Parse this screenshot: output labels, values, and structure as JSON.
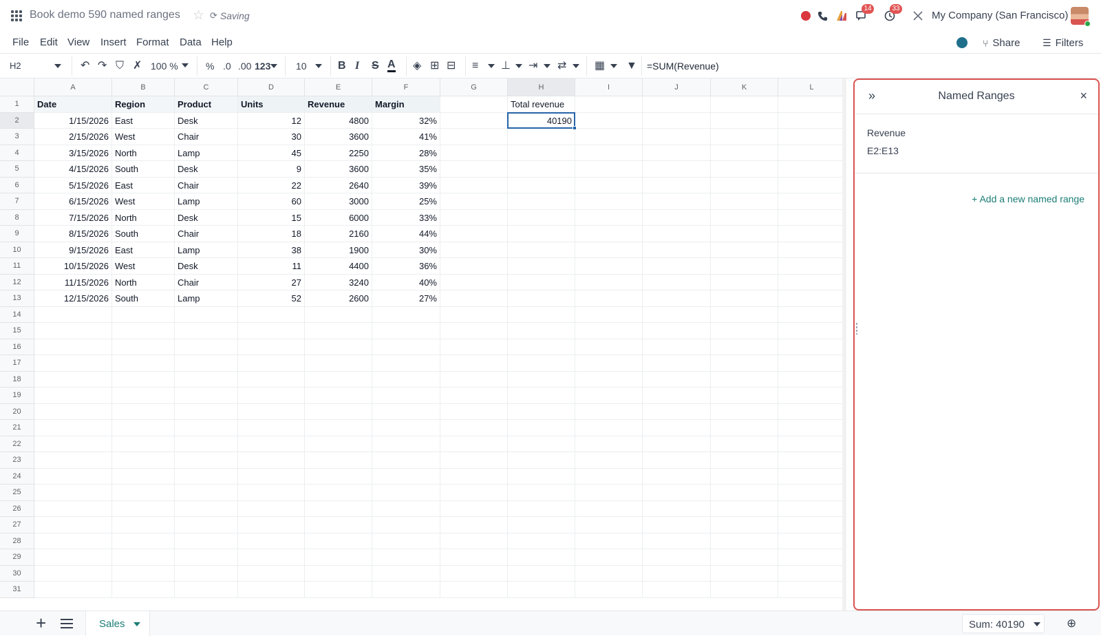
{
  "app": {
    "doc_title": "Book demo 590 named ranges",
    "saving_label": "Saving",
    "company": "My Company (San Francisco)",
    "badges": {
      "messages": "14",
      "activities": "33"
    }
  },
  "menu": [
    "File",
    "Edit",
    "View",
    "Insert",
    "Format",
    "Data",
    "Help"
  ],
  "actions": {
    "share": "Share",
    "filters": "Filters"
  },
  "toolbar": {
    "cell_ref": "H2",
    "zoom": "100 %",
    "percent": "%",
    "dec_minus": ".0",
    "dec_plus": ".00",
    "num_format": "123",
    "font_size": "10",
    "formula": "=SUM(Revenue)"
  },
  "grid": {
    "columns": [
      "A",
      "B",
      "C",
      "D",
      "E",
      "F",
      "G",
      "H",
      "I",
      "J",
      "K",
      "L"
    ],
    "row_count": 31,
    "header_row": [
      "Date",
      "Region",
      "Product",
      "Units",
      "Revenue",
      "Margin"
    ],
    "rows": [
      [
        "1/15/2026",
        "East",
        "Desk",
        "12",
        "4800",
        "32%"
      ],
      [
        "2/15/2026",
        "West",
        "Chair",
        "30",
        "3600",
        "41%"
      ],
      [
        "3/15/2026",
        "North",
        "Lamp",
        "45",
        "2250",
        "28%"
      ],
      [
        "4/15/2026",
        "South",
        "Desk",
        "9",
        "3600",
        "35%"
      ],
      [
        "5/15/2026",
        "East",
        "Chair",
        "22",
        "2640",
        "39%"
      ],
      [
        "6/15/2026",
        "West",
        "Lamp",
        "60",
        "3000",
        "25%"
      ],
      [
        "7/15/2026",
        "North",
        "Desk",
        "15",
        "6000",
        "33%"
      ],
      [
        "8/15/2026",
        "South",
        "Chair",
        "18",
        "2160",
        "44%"
      ],
      [
        "9/15/2026",
        "East",
        "Lamp",
        "38",
        "1900",
        "30%"
      ],
      [
        "10/15/2026",
        "West",
        "Desk",
        "11",
        "4400",
        "36%"
      ],
      [
        "11/15/2026",
        "North",
        "Chair",
        "27",
        "3240",
        "40%"
      ],
      [
        "12/15/2026",
        "South",
        "Lamp",
        "52",
        "2600",
        "27%"
      ]
    ],
    "total_label": "Total revenue",
    "total_value": "40190"
  },
  "panel": {
    "title": "Named Ranges",
    "ranges": [
      {
        "name": "Revenue",
        "range": "E2:E13"
      }
    ],
    "add_label": "+ Add a new named range"
  },
  "bottom": {
    "sheet_name": "Sales",
    "sum_label": "Sum: 40190"
  },
  "colors": {
    "accent": "#1b7d75",
    "panel_border": "#d9534f",
    "selection": "#2563a8"
  }
}
